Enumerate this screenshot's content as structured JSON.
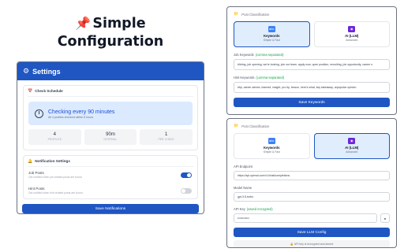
{
  "hero": {
    "pin": "📌",
    "line1": "Simple",
    "line2": "Configuration"
  },
  "settings": {
    "title": "Settings",
    "check_schedule": {
      "title": "Check Schedule",
      "main": "Checking every 90 minutes",
      "sub": "All 4 profiles checked within 6 hours",
      "stats": [
        {
          "value": "4",
          "label": "PROFILES"
        },
        {
          "value": "90m",
          "label": "INTERVAL"
        },
        {
          "value": "1",
          "label": "PER CHECK"
        }
      ]
    },
    "notifications": {
      "title": "Notification Settings",
      "items": [
        {
          "title": "Job Posts",
          "sub": "Get notified when job-related posts are found",
          "on": true
        },
        {
          "title": "Hint Posts",
          "sub": "Get notified when hint-related posts are found",
          "on": false
        }
      ],
      "save_label": "Save Notifications"
    }
  },
  "keywords_card": {
    "title": "Post Classification",
    "options": [
      {
        "name": "Keywords",
        "sub": "Simple & Fast"
      },
      {
        "name": "AI (LLM)",
        "sub": "Advanced"
      }
    ],
    "job_label": "Job Keywords",
    "job_hint": "(comma-separated)",
    "job_value": "#hiring, job opening, we're looking, join our team, apply now, open position, recruiting, job opportunity, career o",
    "hint_label": "Hint Keywords",
    "hint_hint": "(comma-separated)",
    "hint_value": "#tip, career advice, learned, insight, pro tip, lesson, here's what, key takeaway, unpopular opinion",
    "save_label": "Save Keywords"
  },
  "llm_card": {
    "title": "Post Classification",
    "options": [
      {
        "name": "Keywords",
        "sub": "Simple & Fast"
      },
      {
        "name": "AI (LLM)",
        "sub": "Advanced"
      }
    ],
    "endpoint_label": "API Endpoint",
    "endpoint_value": "https://api.openai.com/v1/chat/completions",
    "model_label": "Model Name",
    "model_value": "gpt-3.5-turbo",
    "key_label": "API Key",
    "key_hint": "(saved encrypted)",
    "key_value": "••••••••••••",
    "save_label": "Save LLM Config",
    "note": "🔒 API key is encrypted and stored"
  }
}
